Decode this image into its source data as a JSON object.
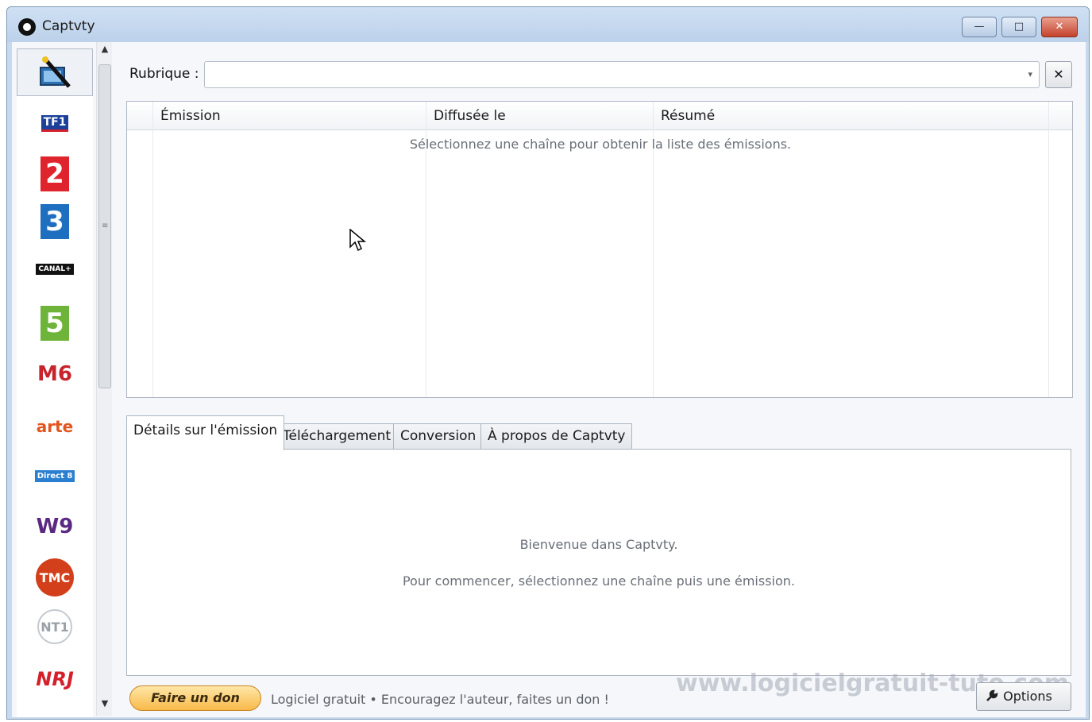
{
  "window": {
    "title": "Captvty"
  },
  "channels": [
    {
      "icon": "magic-wand-icon",
      "name": ""
    },
    {
      "icon": "tf1-logo",
      "name": "TF1"
    },
    {
      "icon": "france2-logo",
      "name": "2"
    },
    {
      "icon": "france3-logo",
      "name": "3"
    },
    {
      "icon": "canalplus-logo",
      "name": "CANAL+"
    },
    {
      "icon": "france5-logo",
      "name": "5"
    },
    {
      "icon": "m6-logo",
      "name": "M6"
    },
    {
      "icon": "arte-logo",
      "name": "arte"
    },
    {
      "icon": "direct8-logo",
      "name": "Direct 8"
    },
    {
      "icon": "w9-logo",
      "name": "W9"
    },
    {
      "icon": "tmc-logo",
      "name": "TMC"
    },
    {
      "icon": "nt1-logo",
      "name": "NT1"
    },
    {
      "icon": "nrj12-logo",
      "name": "NRJ"
    }
  ],
  "rubrique": {
    "label": "Rubrique :",
    "value": ""
  },
  "grid": {
    "columns": [
      "Émission",
      "Diffusée le",
      "Résumé"
    ],
    "empty_message": "Sélectionnez une chaîne pour obtenir la liste des émissions."
  },
  "tabs": [
    "Détails sur l'émission",
    "Téléchargement",
    "Conversion",
    "À propos de Captvty"
  ],
  "details": {
    "welcome": "Bienvenue dans Captvty.",
    "instructions": "Pour commencer, sélectionnez une chaîne puis une émission."
  },
  "footer": {
    "donate_label": "Faire un don",
    "tagline": "Logiciel gratuit  •  Encouragez l'auteur, faites un don !",
    "watermark": "www.logicielgratuit-tuto.com",
    "options_label": "Options"
  },
  "colors": {
    "accent": "#c7d9ee",
    "donate": "#f8b94a"
  }
}
